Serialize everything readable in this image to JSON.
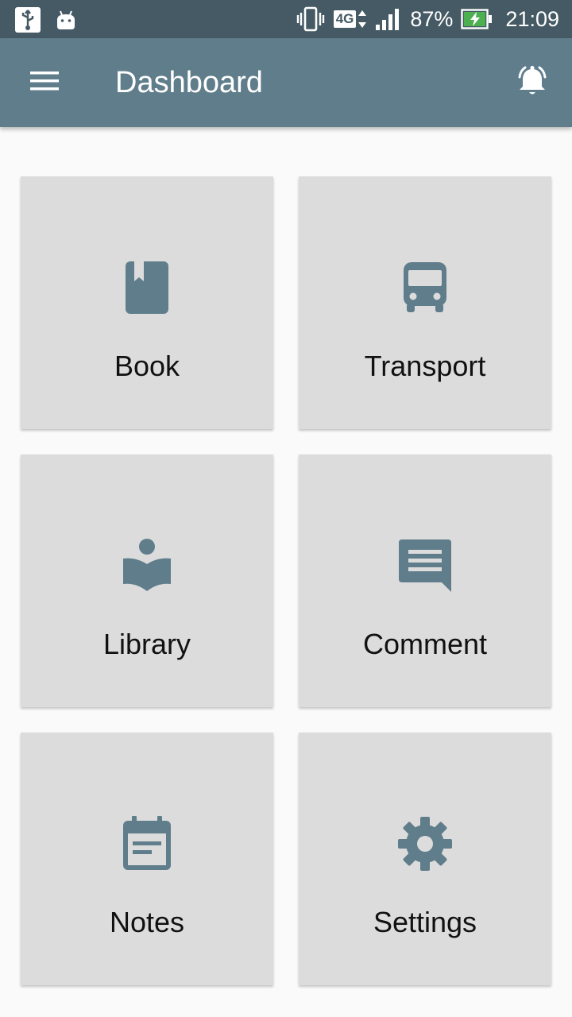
{
  "status_bar": {
    "network": "4G",
    "battery": "87%",
    "time": "21:09"
  },
  "app_bar": {
    "title": "Dashboard"
  },
  "colors": {
    "status_bar": "#455a64",
    "app_bar": "#607d8b",
    "icon": "#607d8b",
    "card": "#dcdcdc",
    "background": "#fafafa"
  },
  "tiles": [
    {
      "label": "Book",
      "icon": "book-icon"
    },
    {
      "label": "Transport",
      "icon": "bus-icon"
    },
    {
      "label": "Library",
      "icon": "library-icon"
    },
    {
      "label": "Comment",
      "icon": "comment-icon"
    },
    {
      "label": "Notes",
      "icon": "calendar-note-icon"
    },
    {
      "label": "Settings",
      "icon": "gear-icon"
    }
  ]
}
